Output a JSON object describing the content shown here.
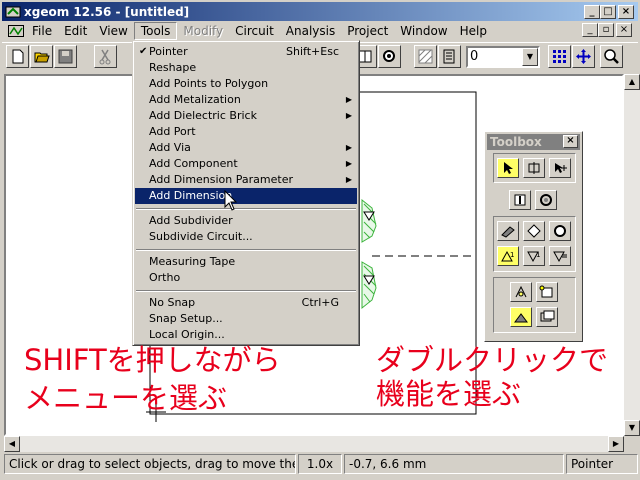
{
  "window": {
    "title": "xgeom 12.56 - [untitled]",
    "min": "_",
    "max": "□",
    "close": "×"
  },
  "menubar": {
    "items": [
      "File",
      "Edit",
      "View",
      "Tools",
      "Modify",
      "Circuit",
      "Analysis",
      "Project",
      "Window",
      "Help"
    ]
  },
  "toolbar": {
    "level_value": "0"
  },
  "tools_menu": {
    "items": [
      {
        "label": "Pointer",
        "shortcut": "Shift+Esc",
        "checked": true
      },
      {
        "label": "Reshape"
      },
      {
        "label": "Add Points to Polygon"
      },
      {
        "label": "Add Metalization",
        "submenu": true
      },
      {
        "label": "Add Dielectric Brick",
        "submenu": true
      },
      {
        "label": "Add Port"
      },
      {
        "label": "Add Via",
        "submenu": true
      },
      {
        "label": "Add Component",
        "submenu": true
      },
      {
        "label": "Add Dimension Parameter",
        "submenu": true
      },
      {
        "label": "Add Dimension",
        "highlighted": true
      },
      {
        "label": "Add Subdivider"
      },
      {
        "label": "Subdivide Circuit..."
      },
      {
        "label": "Measuring Tape"
      },
      {
        "label": "Ortho"
      },
      {
        "label": "No Snap",
        "shortcut": "Ctrl+G"
      },
      {
        "label": "Snap Setup..."
      },
      {
        "label": "Local Origin..."
      }
    ]
  },
  "toolbox": {
    "title": "Toolbox",
    "close": "×"
  },
  "annotations": {
    "left_line1": "SHIFTを押しながら",
    "left_line2": "メニューを選ぶ",
    "right_line1": "ダブルクリックで",
    "right_line2": "機能を選ぶ"
  },
  "status": {
    "message": "Click or drag to select objects, drag to move them",
    "zoom": "1.0x",
    "coords": "-0.7, 6.6 mm",
    "mode": "Pointer"
  },
  "colors": {
    "title_start": "#0a246a",
    "highlight": "#0a246a",
    "annotation": "#e8001c",
    "metal": "#3cb43c",
    "tool_active": "#ffff66"
  }
}
